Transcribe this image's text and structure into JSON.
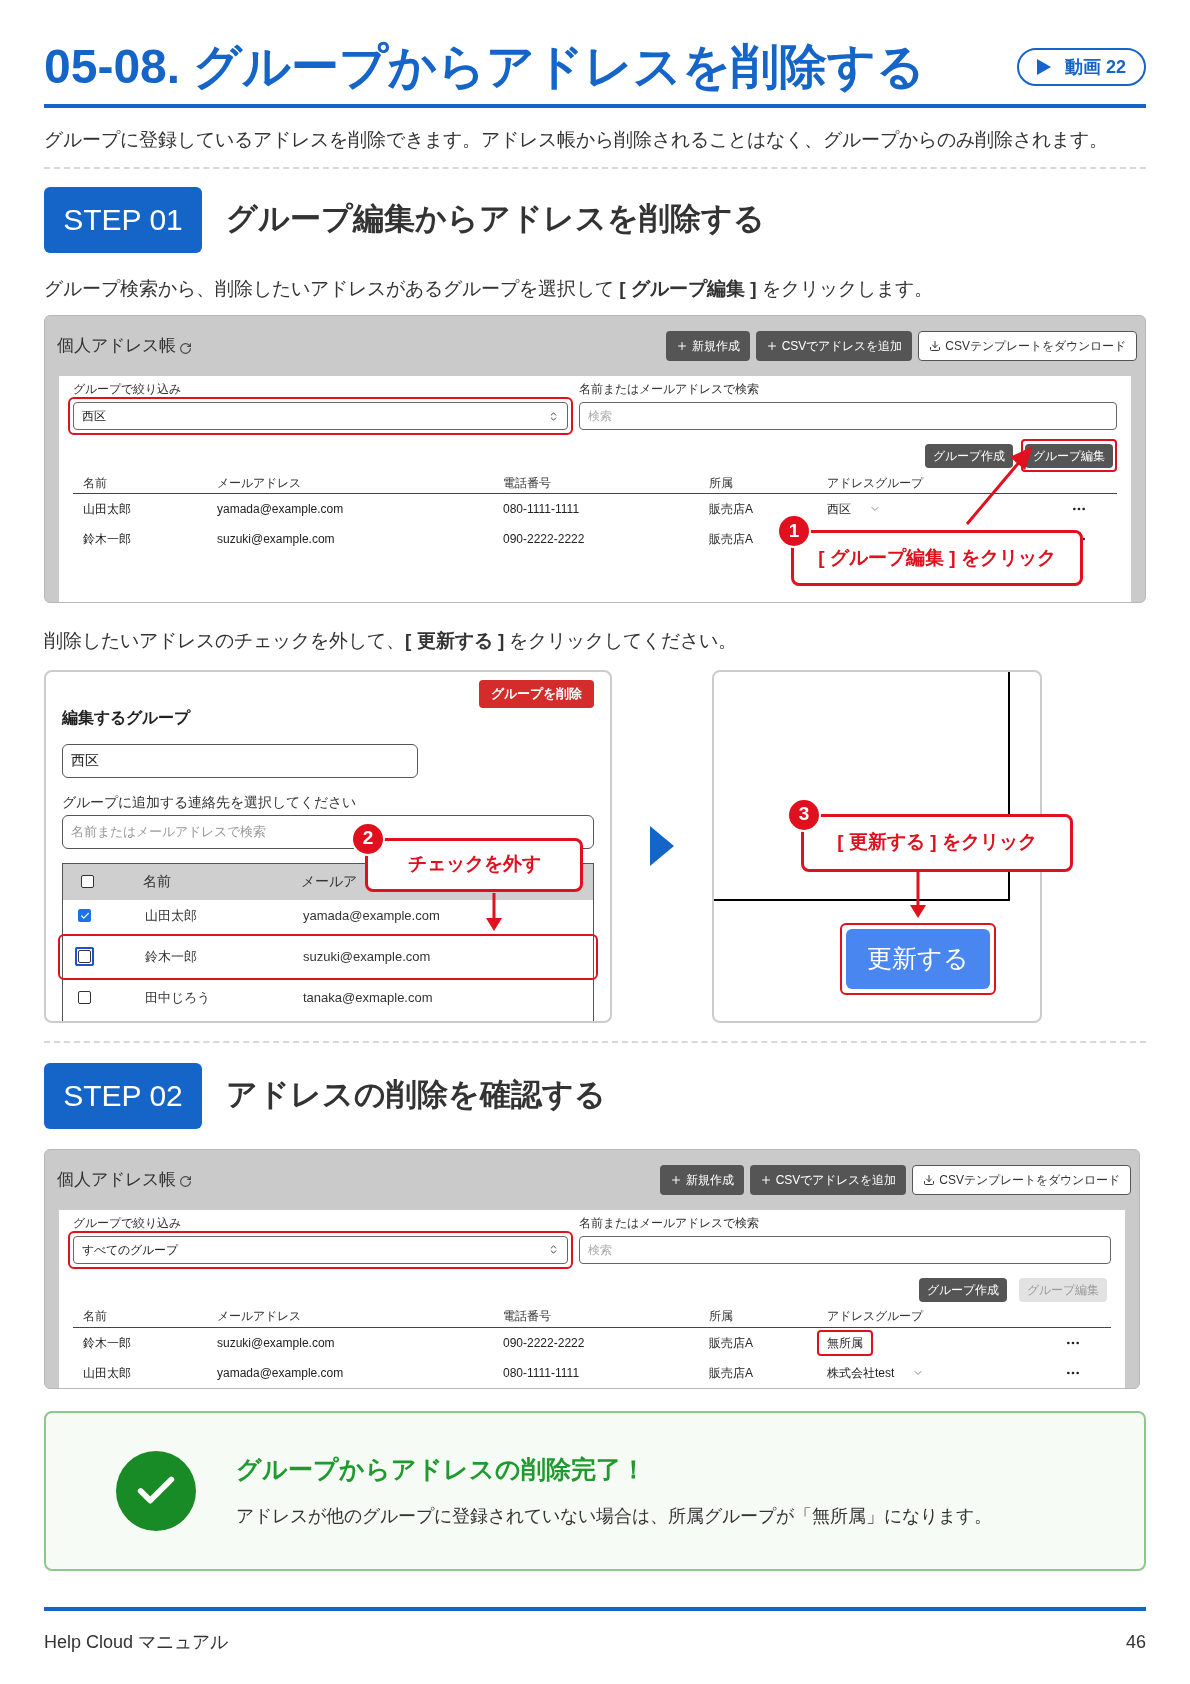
{
  "header": {
    "title": "05-08. グループからアドレスを削除する",
    "video_badge": "動画 22"
  },
  "intro": "グループに登録しているアドレスを削除できます。アドレス帳から削除されることはなく、グループからのみ削除されます。",
  "step_01": {
    "badge": "STEP 01",
    "title": "グループ編集からアドレスを削除する",
    "instruction": "グループ検索から、削除したいアドレスがあるグループを選択して **[ グループ編集 ]** をクリックします。",
    "screen": {
      "title": "個人アドレス帳",
      "toolbar_buttons": [
        {
          "label": "新規作成",
          "kind": "add"
        },
        {
          "label": "CSVでアドレスを追加",
          "kind": "add"
        },
        {
          "label": "CSVテンプレートをダウンロード",
          "kind": "download"
        }
      ],
      "filter": {
        "label": "グループで絞り込み",
        "value": "西区",
        "highlighted": true
      },
      "search": {
        "label": "名前またはメールアドレスで検索",
        "placeholder": "検索"
      },
      "group_buttons": [
        {
          "label": "グループ作成",
          "disabled": false
        },
        {
          "label": "グループ編集",
          "disabled": false,
          "highlighted": true
        }
      ],
      "columns": [
        "名前",
        "メールアドレス",
        "電話番号",
        "所属",
        "アドレスグループ"
      ],
      "rows": [
        {
          "name": "山田太郎",
          "email": "yamada@example.com",
          "phone": "080-1111-1111",
          "affiliation": "販売店A",
          "group": "西区",
          "group_dropdown": true
        },
        {
          "name": "鈴木一郎",
          "email": "suzuki@example.com",
          "phone": "090-2222-2222",
          "affiliation": "販売店A"
        }
      ]
    },
    "callout": {
      "number": "1",
      "text": "[ グループ編集 ] をクリック"
    },
    "instruction_2": "削除したいアドレスのチェックを外して、**[ 更新する ]** をクリックしてください。",
    "edit_panel": {
      "delete_button": "グループを削除",
      "heading": "編集するグループ",
      "group_name": "西区",
      "contacts_label": "グループに追加する連絡先を選択してください",
      "contact_search": {
        "placeholder": "名前またはメールアドレスで検索"
      },
      "select_all_checked": false,
      "columns": [
        "名前",
        "メールア"
      ],
      "contacts": [
        {
          "name": "山田太郎",
          "email": "yamada@example.com",
          "checked": true
        },
        {
          "name": "鈴木一郎",
          "email": "suzuki@example.com",
          "checked": false,
          "highlighted": true,
          "focused": true
        },
        {
          "name": "田中じろう",
          "email": "tanaka@exmaple.com",
          "checked": false
        }
      ],
      "callout": {
        "number": "2",
        "text": "チェックを外す"
      }
    },
    "update_panel": {
      "update_button": "更新する",
      "highlighted": true,
      "callout": {
        "number": "3",
        "text": "[ 更新する ] をクリック"
      }
    }
  },
  "step_02": {
    "badge": "STEP 02",
    "title": "アドレスの削除を確認する",
    "screen": {
      "title": "個人アドレス帳",
      "toolbar_buttons": [
        {
          "label": "新規作成",
          "kind": "add"
        },
        {
          "label": "CSVでアドレスを追加",
          "kind": "add"
        },
        {
          "label": "CSVテンプレートをダウンロード",
          "kind": "download"
        }
      ],
      "filter": {
        "label": "グループで絞り込み",
        "value": "すべてのグループ",
        "highlighted": true
      },
      "search": {
        "label": "名前またはメールアドレスで検索",
        "placeholder": "検索"
      },
      "group_buttons": [
        {
          "label": "グループ作成",
          "disabled": false
        },
        {
          "label": "グループ編集",
          "disabled": true
        }
      ],
      "columns": [
        "名前",
        "メールアドレス",
        "電話番号",
        "所属",
        "アドレスグループ"
      ],
      "rows": [
        {
          "name": "鈴木一郎",
          "email": "suzuki@example.com",
          "phone": "090-2222-2222",
          "affiliation": "販売店A",
          "group": "無所属",
          "group_highlighted": true
        },
        {
          "name": "山田太郎",
          "email": "yamada@example.com",
          "phone": "080-1111-1111",
          "affiliation": "販売店A",
          "group": "株式会社test",
          "group_dropdown": true
        }
      ]
    }
  },
  "completion": {
    "title": "グループからアドレスの削除完了！",
    "message": "アドレスが他のグループに登録されていない場合は、所属グループが「無所属」になります。"
  },
  "footer": {
    "manual": "Help Cloud マニュアル",
    "page": "46"
  }
}
